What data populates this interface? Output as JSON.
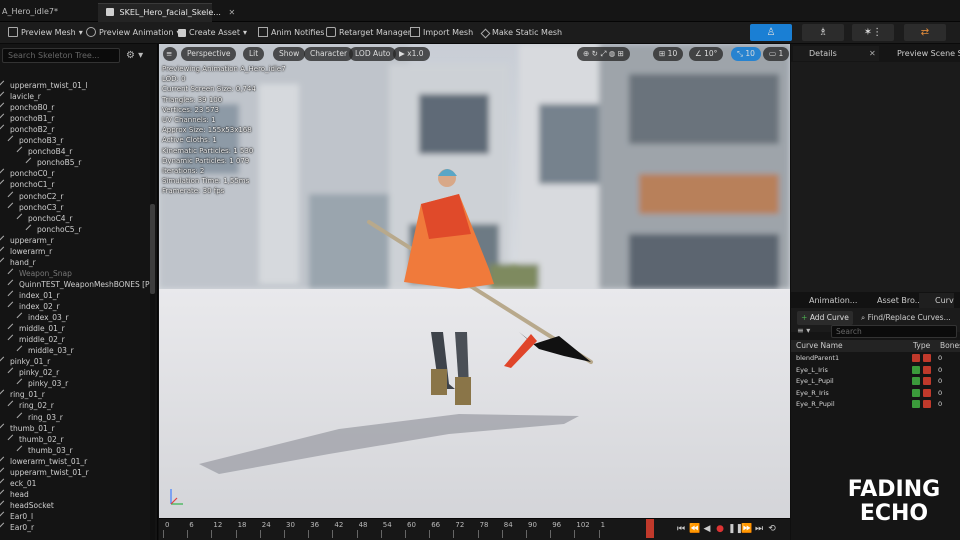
{
  "tabs": [
    {
      "label": "A_Hero_idle7*"
    },
    {
      "label": "SKEL_Hero_facial_Skele..."
    }
  ],
  "toolbar": {
    "preview_mesh": "Preview Mesh",
    "preview_animation": "Preview Animation",
    "create_asset": "Create Asset",
    "anim_notifies": "Anim Notifies",
    "retarget_manager": "Retarget Manager",
    "import_mesh": "Import Mesh",
    "make_static_mesh": "Make Static Mesh"
  },
  "skeleton_tree": {
    "search_placeholder": "Search Skeleton Tree...",
    "bones": [
      {
        "label": "upperarm_twist_01_l",
        "indent": 0
      },
      {
        "label": "lavicle_r",
        "indent": 0
      },
      {
        "label": "ponchoB0_r",
        "indent": 0
      },
      {
        "label": "ponchoB1_r",
        "indent": 0
      },
      {
        "label": "ponchoB2_r",
        "indent": 0
      },
      {
        "label": "ponchoB3_r",
        "indent": 1
      },
      {
        "label": "ponchoB4_r",
        "indent": 2
      },
      {
        "label": "ponchoB5_r",
        "indent": 3
      },
      {
        "label": "ponchoC0_r",
        "indent": 0
      },
      {
        "label": "ponchoC1_r",
        "indent": 0
      },
      {
        "label": "ponchoC2_r",
        "indent": 1
      },
      {
        "label": "ponchoC3_r",
        "indent": 1
      },
      {
        "label": "ponchoC4_r",
        "indent": 2
      },
      {
        "label": "ponchoC5_r",
        "indent": 3
      },
      {
        "label": "upperarm_r",
        "indent": 0
      },
      {
        "label": "lowerarm_r",
        "indent": 0
      },
      {
        "label": "hand_r",
        "indent": 0
      },
      {
        "label": "Weapon_Snap",
        "indent": 1
      },
      {
        "label": "QuinnTEST_WeaponMeshBONES [Prev",
        "indent": 1
      },
      {
        "label": "index_01_r",
        "indent": 1
      },
      {
        "label": "index_02_r",
        "indent": 1
      },
      {
        "label": "index_03_r",
        "indent": 2
      },
      {
        "label": "middle_01_r",
        "indent": 1
      },
      {
        "label": "middle_02_r",
        "indent": 1
      },
      {
        "label": "middle_03_r",
        "indent": 2
      },
      {
        "label": "pinky_01_r",
        "indent": 0
      },
      {
        "label": "pinky_02_r",
        "indent": 1
      },
      {
        "label": "pinky_03_r",
        "indent": 2
      },
      {
        "label": "ring_01_r",
        "indent": 0
      },
      {
        "label": "ring_02_r",
        "indent": 1
      },
      {
        "label": "ring_03_r",
        "indent": 2
      },
      {
        "label": "thumb_01_r",
        "indent": 0
      },
      {
        "label": "thumb_02_r",
        "indent": 1
      },
      {
        "label": "thumb_03_r",
        "indent": 2
      },
      {
        "label": "lowerarm_twist_01_r",
        "indent": 0
      },
      {
        "label": "upperarm_twist_01_r",
        "indent": 0
      },
      {
        "label": "eck_01",
        "indent": 0
      },
      {
        "label": "head",
        "indent": 0
      },
      {
        "label": "headSocket",
        "indent": 0
      },
      {
        "label": "Ear0_l",
        "indent": 0
      },
      {
        "label": "Ear0_r",
        "indent": 0
      }
    ]
  },
  "viewport": {
    "perspective": "Perspective",
    "lit": "Lit",
    "show": "Show",
    "character": "Character",
    "lod": "LOD Auto",
    "play_speed": "x1.0",
    "grid_snap": "10",
    "angle_snap": "10°",
    "scale_snap": "10",
    "camera_speed": "1",
    "stats": [
      "Previewing Animation A_Hero_idle7",
      "LOD: 0",
      "Current Screen Size: 0,744",
      "Triangles: 39 100",
      "Vertices: 23 573",
      "UV Channels: 1",
      "Approx Size: 155x53x168",
      "Active Cloths: 1",
      "Kinematic Particles: 1 530",
      "Dynamic Particles: 1 079",
      "Iterations: 2",
      "Simulation Time: 1,55ms",
      "Framerate: 30 fps"
    ]
  },
  "timeline": {
    "ticks": [
      "0",
      "6",
      "12",
      "18",
      "24",
      "30",
      "36",
      "42",
      "48",
      "54",
      "60",
      "66",
      "72",
      "78",
      "84",
      "90",
      "96",
      "102",
      "1"
    ]
  },
  "right_panel": {
    "details_tab": "Details",
    "preview_tab": "Preview Scene S...",
    "lower_tabs": [
      "Animation...",
      "Asset Bro...",
      "Curv"
    ],
    "add_curve": "Add Curve",
    "find_replace": "Find/Replace Curves...",
    "search_placeholder": "Search",
    "columns": {
      "name": "Curve Name",
      "type": "Type",
      "bones": "Bones"
    },
    "curves": [
      {
        "name": "blendParent1",
        "value": "0"
      },
      {
        "name": "Eye_L_Iris",
        "value": "0"
      },
      {
        "name": "Eye_L_Pupil",
        "value": "0"
      },
      {
        "name": "Eye_R_Iris",
        "value": "0"
      },
      {
        "name": "Eye_R_Pupil",
        "value": "0"
      }
    ]
  },
  "watermark": {
    "line1": "FADING",
    "line2": "ECHO"
  },
  "colors": {
    "accent_blue": "#1a7fd4",
    "orange": "#d9803a",
    "playhead": "#c0392b"
  }
}
